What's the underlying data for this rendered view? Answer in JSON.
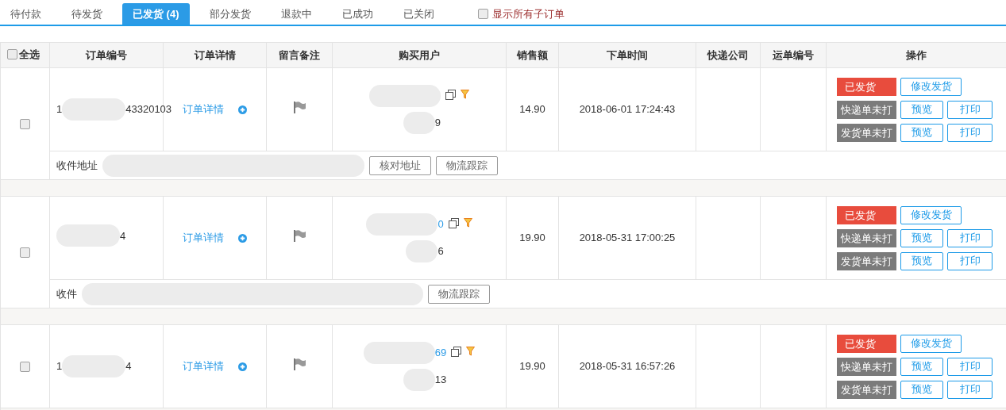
{
  "tabs": [
    {
      "label": "待付款",
      "selected": false
    },
    {
      "label": "待发货",
      "selected": false
    },
    {
      "label": "已发货 (4)",
      "selected": true
    },
    {
      "label": "部分发货",
      "selected": false
    },
    {
      "label": "退款中",
      "selected": false
    },
    {
      "label": "已成功",
      "selected": false
    },
    {
      "label": "已关闭",
      "selected": false
    }
  ],
  "show_all_suborders": {
    "label": "显示所有子订单",
    "checked": false
  },
  "table": {
    "select_all": {
      "label": "全选",
      "checked": false
    },
    "columns": [
      "订单编号",
      "订单详情",
      "留言备注",
      "购买用户",
      "销售额",
      "下单时间",
      "快递公司",
      "运单编号",
      "操作"
    ],
    "orders": [
      {
        "checked": false,
        "order_no_start": "1",
        "order_no_end": "43320103",
        "detail_link": "订单详情",
        "buyer_phone_end": "9",
        "amount": "14.90",
        "time": "2018-06-01 17:24:43",
        "status": "已发货",
        "modify": "修改发货",
        "prints": [
          {
            "label": "快递单未打",
            "preview": "预览",
            "print": "打印"
          },
          {
            "label": "发货单未打",
            "preview": "预览",
            "print": "打印"
          }
        ],
        "address": {
          "label": "收件地址",
          "buttons": [
            "核对地址",
            "物流跟踪"
          ]
        }
      },
      {
        "checked": false,
        "order_no_end": "4",
        "detail_link": "订单详情",
        "buyer_name_end": "0",
        "buyer_phone_end": "6",
        "amount": "19.90",
        "time": "2018-05-31 17:00:25",
        "status": "已发货",
        "modify": "修改发货",
        "prints": [
          {
            "label": "快递单未打",
            "preview": "预览",
            "print": "打印"
          },
          {
            "label": "发货单未打",
            "preview": "预览",
            "print": "打印"
          }
        ],
        "address": {
          "label": "收件",
          "buttons": [
            "物流跟踪"
          ]
        }
      },
      {
        "checked": false,
        "order_no_start": "1",
        "order_no_end": "4",
        "detail_link": "订单详情",
        "buyer_name_end": "69",
        "buyer_phone_end": "13",
        "amount": "19.90",
        "time": "2018-05-31 16:57:26",
        "status": "已发货",
        "modify": "修改发货",
        "prints": [
          {
            "label": "快递单未打",
            "preview": "预览",
            "print": "打印"
          },
          {
            "label": "发货单未打",
            "preview": "预览",
            "print": "打印"
          }
        ]
      }
    ]
  }
}
